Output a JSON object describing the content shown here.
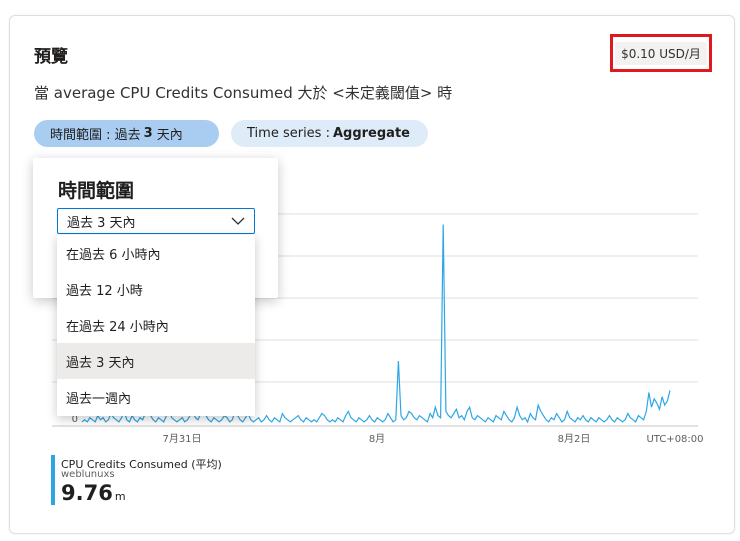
{
  "card": {
    "title": "預覽",
    "price": "$0.10 USD/月",
    "condition": "當 average CPU Credits Consumed 大於 <未定義閾值> 時"
  },
  "pills": {
    "time_label": "時間範圍 : 過去",
    "time_value": "3",
    "time_suffix": "天內",
    "series_label": "Time series :",
    "series_value": "Aggregate"
  },
  "popup": {
    "title": "時間範圍",
    "selected": "過去 3 天內",
    "options": [
      "在過去 6 小時內",
      "過去 12 小時",
      "在過去 24 小時內",
      "過去 3 天內",
      "過去一週內"
    ],
    "selected_index": 3
  },
  "chart_data": {
    "type": "line",
    "x_ticks": [
      "7月31日",
      "8月",
      "8月2日",
      "UTC+08:00"
    ],
    "y_ticks": [
      "0"
    ],
    "series": [
      {
        "name": "CPU Credits Consumed (平均)",
        "color": "#2ea6e6",
        "values": [
          1,
          2,
          1,
          3,
          2,
          1,
          4,
          2,
          3,
          1,
          2,
          5,
          3,
          2,
          1,
          3,
          6,
          2,
          1,
          4,
          2,
          1,
          3,
          2,
          5,
          9,
          4,
          2,
          1,
          3,
          2,
          1,
          4,
          7,
          3,
          2,
          1,
          2,
          3,
          1,
          2,
          4,
          6,
          3,
          2,
          5,
          8,
          4,
          2,
          1,
          3,
          2,
          1,
          2,
          4,
          3,
          1,
          2,
          6,
          4,
          2,
          1,
          3,
          5,
          2,
          1,
          2,
          3,
          1,
          2,
          4,
          2,
          1,
          3,
          2,
          1,
          5,
          3,
          2,
          1,
          2,
          3,
          4,
          2,
          1,
          3,
          2,
          1,
          2,
          1,
          3,
          5,
          4,
          2,
          1,
          2,
          1,
          3,
          2,
          1,
          4,
          6,
          3,
          2,
          1,
          3,
          2,
          1,
          2,
          4,
          2,
          1,
          3,
          2,
          1,
          2,
          5,
          3,
          1,
          2,
          30,
          4,
          2,
          3,
          6,
          5,
          3,
          2,
          4,
          3,
          2,
          1,
          5,
          3,
          8,
          4,
          3,
          95,
          6,
          4,
          3,
          5,
          7,
          3,
          4,
          2,
          6,
          8,
          3,
          2,
          4,
          3,
          2,
          1,
          3,
          2,
          1,
          4,
          3,
          2,
          6,
          4,
          2,
          1,
          3,
          8,
          4,
          2,
          3,
          1,
          5,
          3,
          2,
          9,
          6,
          4,
          2,
          1,
          3,
          2,
          5,
          3,
          1,
          2,
          6,
          3,
          2,
          1,
          3,
          2,
          4,
          2,
          1,
          3,
          2,
          1,
          3,
          2,
          1,
          2,
          4,
          2,
          1,
          3,
          2,
          1,
          2,
          5,
          3,
          2,
          1,
          4,
          3,
          2,
          6,
          15,
          8,
          12,
          10,
          7,
          13,
          9,
          11,
          16
        ]
      }
    ]
  },
  "legend": {
    "name": "CPU Credits Consumed (平均)",
    "resource": "weblunuxs",
    "value": "9.76",
    "unit": "m"
  }
}
